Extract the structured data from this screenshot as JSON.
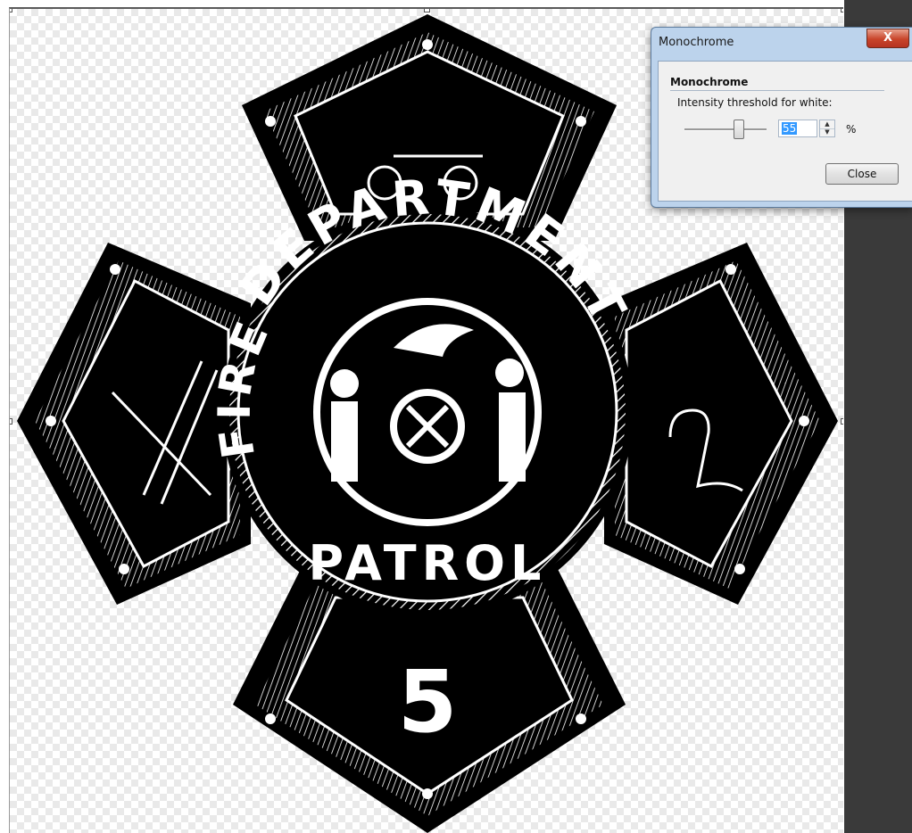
{
  "dialog": {
    "window_title": "Monochrome",
    "close_glyph": "X",
    "group_title": "Monochrome",
    "threshold_label": "Intensity threshold for white:",
    "threshold_value": "55",
    "percent_sign": "%",
    "close_label": "Close"
  },
  "badge": {
    "top_text": "DEPARTMENT",
    "left_text": "FIRE",
    "bottom_text": "PATROL",
    "number": "5"
  },
  "icons": {
    "spin_up": "up-arrow-icon",
    "spin_down": "down-arrow-icon"
  }
}
